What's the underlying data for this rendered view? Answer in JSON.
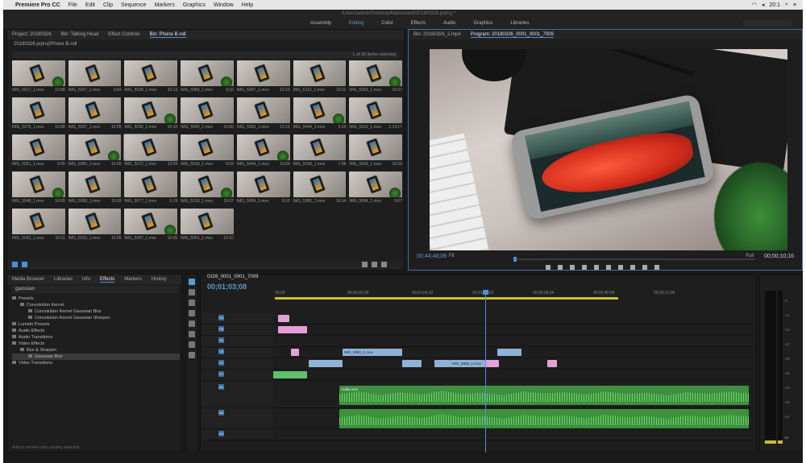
{
  "menubar": {
    "app": "Premiere Pro CC",
    "items": [
      "File",
      "Edit",
      "Clip",
      "Sequence",
      "Markers",
      "Graphics",
      "Window",
      "Help"
    ],
    "status_right": [
      "20:1"
    ]
  },
  "workspace": {
    "path": "/Users/admin/Desktop/Makeuseof/2018/0326.prproj *",
    "tabs": [
      {
        "label": "Assembly"
      },
      {
        "label": "Editing"
      },
      {
        "label": "Color"
      },
      {
        "label": "Effects"
      },
      {
        "label": "Audio"
      },
      {
        "label": "Graphics"
      },
      {
        "label": "Libraries"
      }
    ]
  },
  "project": {
    "tabs": [
      "Project: 20180326",
      "Bin: Talking Head",
      "Effect Controls",
      "Bin: Phone B-roll"
    ],
    "crumb": "20180326.prproj\\Phone B-roll",
    "count": "1 of 36 Items selected",
    "clips": [
      {
        "name": "IMG_5017_1.mov",
        "dur": "10:08"
      },
      {
        "name": "IMG_5027_1.mov",
        "dur": "3:04"
      },
      {
        "name": "IMG_5028_1.mov",
        "dur": "10:13"
      },
      {
        "name": "IMG_5089_1.mov",
        "dur": "9:10"
      },
      {
        "name": "IMG_5097_1.mov",
        "dur": "10:10"
      },
      {
        "name": "IMG_5112_1.mov",
        "dur": "10:11"
      },
      {
        "name": "IMG_5083_1.mov",
        "dur": "10:07"
      },
      {
        "name": "IMG_5076_1.mov",
        "dur": "10:08"
      },
      {
        "name": "IMG_5037_1.mov",
        "dur": "10:05"
      },
      {
        "name": "IMG_5036_1.mov",
        "dur": "10:10"
      },
      {
        "name": "IMG_5040_1.mov",
        "dur": "10:06"
      },
      {
        "name": "IMG_5063_1.mov",
        "dur": "10:13"
      },
      {
        "name": "IMG_5044_1.mov",
        "dur": "3:24"
      },
      {
        "name": "IMG_5102_1.mov",
        "dur": "1:14:17"
      },
      {
        "name": "IMG_5051_1.mov",
        "dur": "9:05"
      },
      {
        "name": "IMG_5055_1.mov",
        "dur": "10:00"
      },
      {
        "name": "IMG_5072_1.mov",
        "dur": "10:04"
      },
      {
        "name": "IMG_5039_1.mov",
        "dur": "9:03"
      },
      {
        "name": "IMG_5044_1.mov",
        "dur": "10:09"
      },
      {
        "name": "IMG_5038_1.mov",
        "dur": "7:08"
      },
      {
        "name": "IMG_5069_1.mov",
        "dur": "10:06"
      },
      {
        "name": "IMG_5048_1.mov",
        "dur": "10:09"
      },
      {
        "name": "IMG_5058_1.mov",
        "dur": "10:03"
      },
      {
        "name": "IMG_5077_1.mov",
        "dur": "5:19"
      },
      {
        "name": "IMG_5106_1.mov",
        "dur": "10:07"
      },
      {
        "name": "IMG_5054_1.mov",
        "dur": "9:10"
      },
      {
        "name": "IMG_5080_1.mov",
        "dur": "10:14"
      },
      {
        "name": "IMG_5084_1.mov",
        "dur": "9:07"
      },
      {
        "name": "IMG_5032_1.mov",
        "dur": "10:11"
      },
      {
        "name": "IMG_5019_1.mov",
        "dur": "10:05"
      },
      {
        "name": "IMG_5087_1.mov",
        "dur": "10:05"
      },
      {
        "name": "IMG_5091_1.mov",
        "dur": "10:10"
      }
    ]
  },
  "program": {
    "tabs": [
      "Bin: 20180326_2.mp4",
      "Program: 20180326_0001_0001_7009"
    ],
    "timecode_left": "00;44;48;09",
    "fit": "Fit",
    "full": "Full",
    "timecode_right": "00;00;10;16"
  },
  "effects": {
    "tabs": [
      "Media Browser",
      "Libraries",
      "Info",
      "Effects",
      "Markers",
      "History"
    ],
    "search": "gaussian",
    "tree": [
      {
        "label": "Presets",
        "level": 0
      },
      {
        "label": "Convolution Kernel",
        "level": 1
      },
      {
        "label": "Convolution Kernel Gaussian Blur",
        "level": 2
      },
      {
        "label": "Convolution Kernel Gaussian Sharpen",
        "level": 2
      },
      {
        "label": "Lumetri Presets",
        "level": 0
      },
      {
        "label": "Audio Effects",
        "level": 0
      },
      {
        "label": "Audio Transitions",
        "level": 0
      },
      {
        "label": "Video Effects",
        "level": 0
      },
      {
        "label": "Blur & Sharpen",
        "level": 1
      },
      {
        "label": "Gaussian Blur",
        "level": 2,
        "selected": true
      },
      {
        "label": "Video Transitions",
        "level": 0
      }
    ],
    "footer": "Add or remove from existing selection"
  },
  "timeline": {
    "sequence": "0326_0001_0001_7009",
    "timecode": "00;01;03;08",
    "ruler": [
      "00;00",
      "00;00;32;00",
      "00;01;04;02",
      "00;01;36;02",
      "00;02;08;04",
      "00;02;40;04",
      "00;03;12;06"
    ],
    "tracks": [
      "V6",
      "V5",
      "V4",
      "V3",
      "V2",
      "V1",
      "A1",
      "A2",
      "A3"
    ],
    "clips": [
      {
        "label": "IMG_5082_1.mov",
        "color": "blue"
      },
      {
        "label": "IMG_5089_1.mov",
        "color": "blue"
      },
      {
        "label": "Audio.mov",
        "color": "green"
      }
    ]
  },
  "meters": {
    "labels": [
      "-6",
      "-12",
      "-18",
      "-24",
      "-30",
      "-36",
      "-42",
      "-48",
      "-54",
      "dB"
    ]
  }
}
